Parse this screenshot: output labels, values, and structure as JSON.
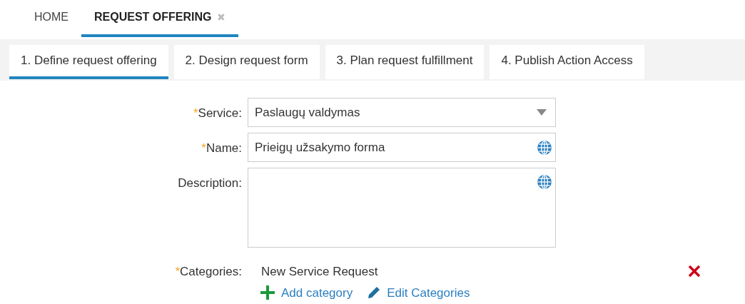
{
  "top_tabs": [
    {
      "label": "HOME",
      "selected": false,
      "closable": false
    },
    {
      "label": "REQUEST OFFERING",
      "selected": true,
      "closable": true
    }
  ],
  "close_glyph": "✖",
  "steps": [
    {
      "label": "1. Define request offering",
      "selected": true
    },
    {
      "label": "2. Design request form",
      "selected": false
    },
    {
      "label": "3. Plan request fulfillment",
      "selected": false
    },
    {
      "label": "4. Publish Action Access",
      "selected": false
    }
  ],
  "form": {
    "fields": [
      {
        "kind": "dropdown",
        "label": "Service:",
        "required": true,
        "value": "Paslaugų valdymas",
        "translatable": false
      },
      {
        "kind": "text",
        "label": "Name:",
        "required": true,
        "value": "Prieigų užsakymo forma",
        "translatable": true
      },
      {
        "kind": "textarea",
        "label": "Description:",
        "required": false,
        "translatable": true
      }
    ],
    "asterisk": "*",
    "categories": {
      "label": "Categories:",
      "required": true,
      "items": [
        "New Service Request"
      ]
    },
    "actions": [
      {
        "kind": "add",
        "label": "Add category"
      },
      {
        "kind": "edit",
        "label": "Edit Categories"
      }
    ]
  }
}
